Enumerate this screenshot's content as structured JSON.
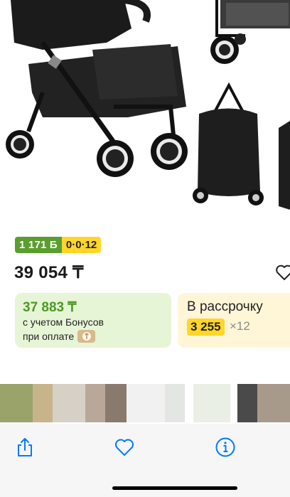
{
  "badges": {
    "bonus": "1 171 Б",
    "installment": "0·0·12"
  },
  "price": "39 054 ₸",
  "bonus_card": {
    "price": "37 883 ₸",
    "line1": "с учетом Бонусов",
    "line2": "при оплате"
  },
  "installment_card": {
    "title": "В рассрочку",
    "amount": "3 255",
    "times": "×12"
  },
  "toolbar": {
    "icons": [
      "share-icon",
      "heart-icon",
      "info-icon"
    ]
  },
  "colors": {
    "bonus_green": "#5a9e2f",
    "accent_yellow": "#ffd629",
    "ios_blue": "#007aff"
  }
}
